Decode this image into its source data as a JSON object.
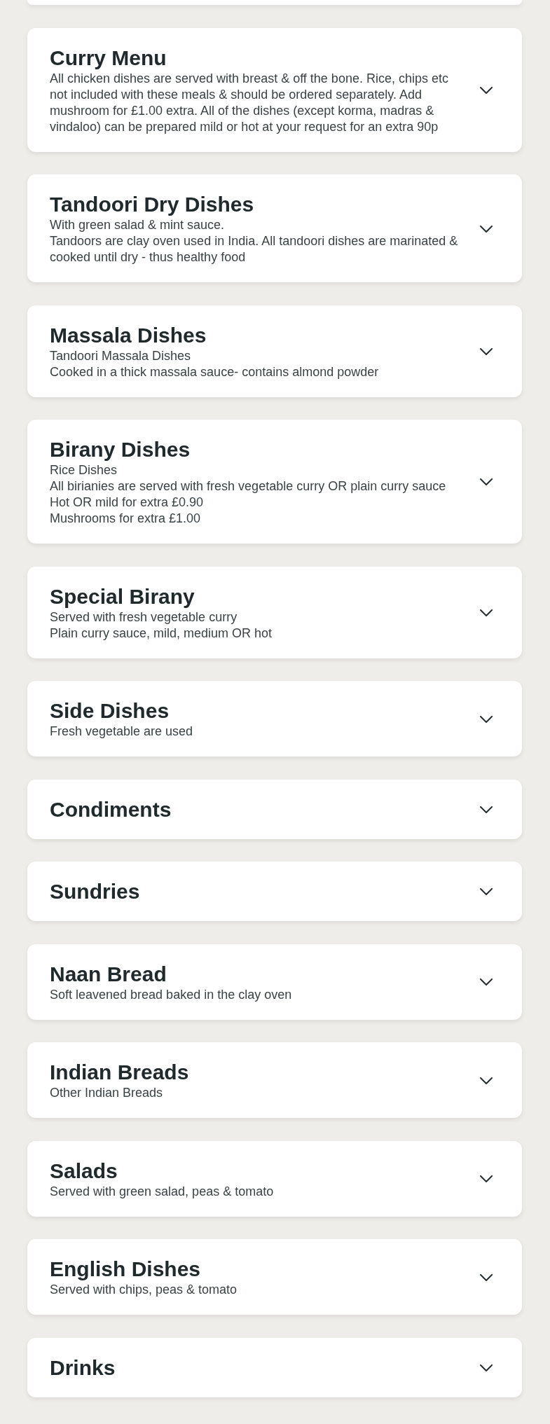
{
  "partial_card_above": true,
  "categories": [
    {
      "title": "Curry Menu",
      "description": [
        "All chicken dishes are served with breast & off the bone. Rice, chips etc not included with these meals & should be ordered separately. Add mushroom for £1.00 extra. All of the dishes (except korma, madras & vindaloo) can be prepared mild or hot at your request for an extra 90p"
      ],
      "expanded": false
    },
    {
      "title": "Tandoori Dry Dishes",
      "description": [
        "With green salad & mint sauce.",
        "Tandoors are clay oven used in India. All tandoori dishes are marinated & cooked until dry - thus healthy food"
      ],
      "expanded": false
    },
    {
      "title": "Massala Dishes",
      "description": [
        "Tandoori Massala Dishes",
        "Cooked in a thick massala sauce- contains almond powder"
      ],
      "expanded": false
    },
    {
      "title": "Birany Dishes",
      "description": [
        "Rice Dishes",
        "All birianies are served with fresh vegetable curry OR plain curry sauce",
        "Hot OR mild for extra £0.90",
        "Mushrooms for extra £1.00"
      ],
      "expanded": false
    },
    {
      "title": "Special Birany",
      "description": [
        "Served with fresh vegetable curry",
        "Plain curry sauce, mild, medium OR hot"
      ],
      "expanded": false
    },
    {
      "title": "Side Dishes",
      "description": [
        "Fresh vegetable are used"
      ],
      "expanded": false
    },
    {
      "title": "Condiments",
      "expanded": false
    },
    {
      "title": "Sundries",
      "expanded": false
    },
    {
      "title": "Naan Bread",
      "description": [
        "Soft leavened bread baked in the clay oven"
      ],
      "expanded": false
    },
    {
      "title": "Indian Breads",
      "description": [
        "Other Indian Breads"
      ],
      "expanded": false
    },
    {
      "title": "Salads",
      "description": [
        "Served with green salad, peas & tomato"
      ],
      "expanded": false
    },
    {
      "title": "English Dishes",
      "description": [
        "Served with chips, peas & tomato"
      ],
      "expanded": false
    },
    {
      "title": "Drinks",
      "expanded": false
    }
  ]
}
